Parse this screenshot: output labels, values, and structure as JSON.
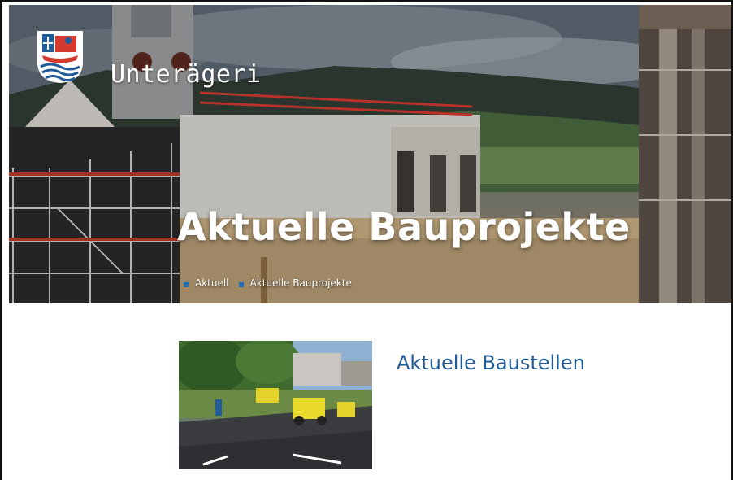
{
  "site": {
    "name": "Unterägeri",
    "logo_icon": "unterageri-coat-of-arms-icon"
  },
  "hero": {
    "title": "Aktuelle Bauprojekte",
    "breadcrumb": [
      {
        "label": "Aktuell"
      },
      {
        "label": "Aktuelle Bauprojekte"
      }
    ]
  },
  "teaser": {
    "title": "Aktuelle Baustellen"
  },
  "colors": {
    "accent": "#1f5c99",
    "breadcrumb_bullet": "#1f6fb2"
  }
}
